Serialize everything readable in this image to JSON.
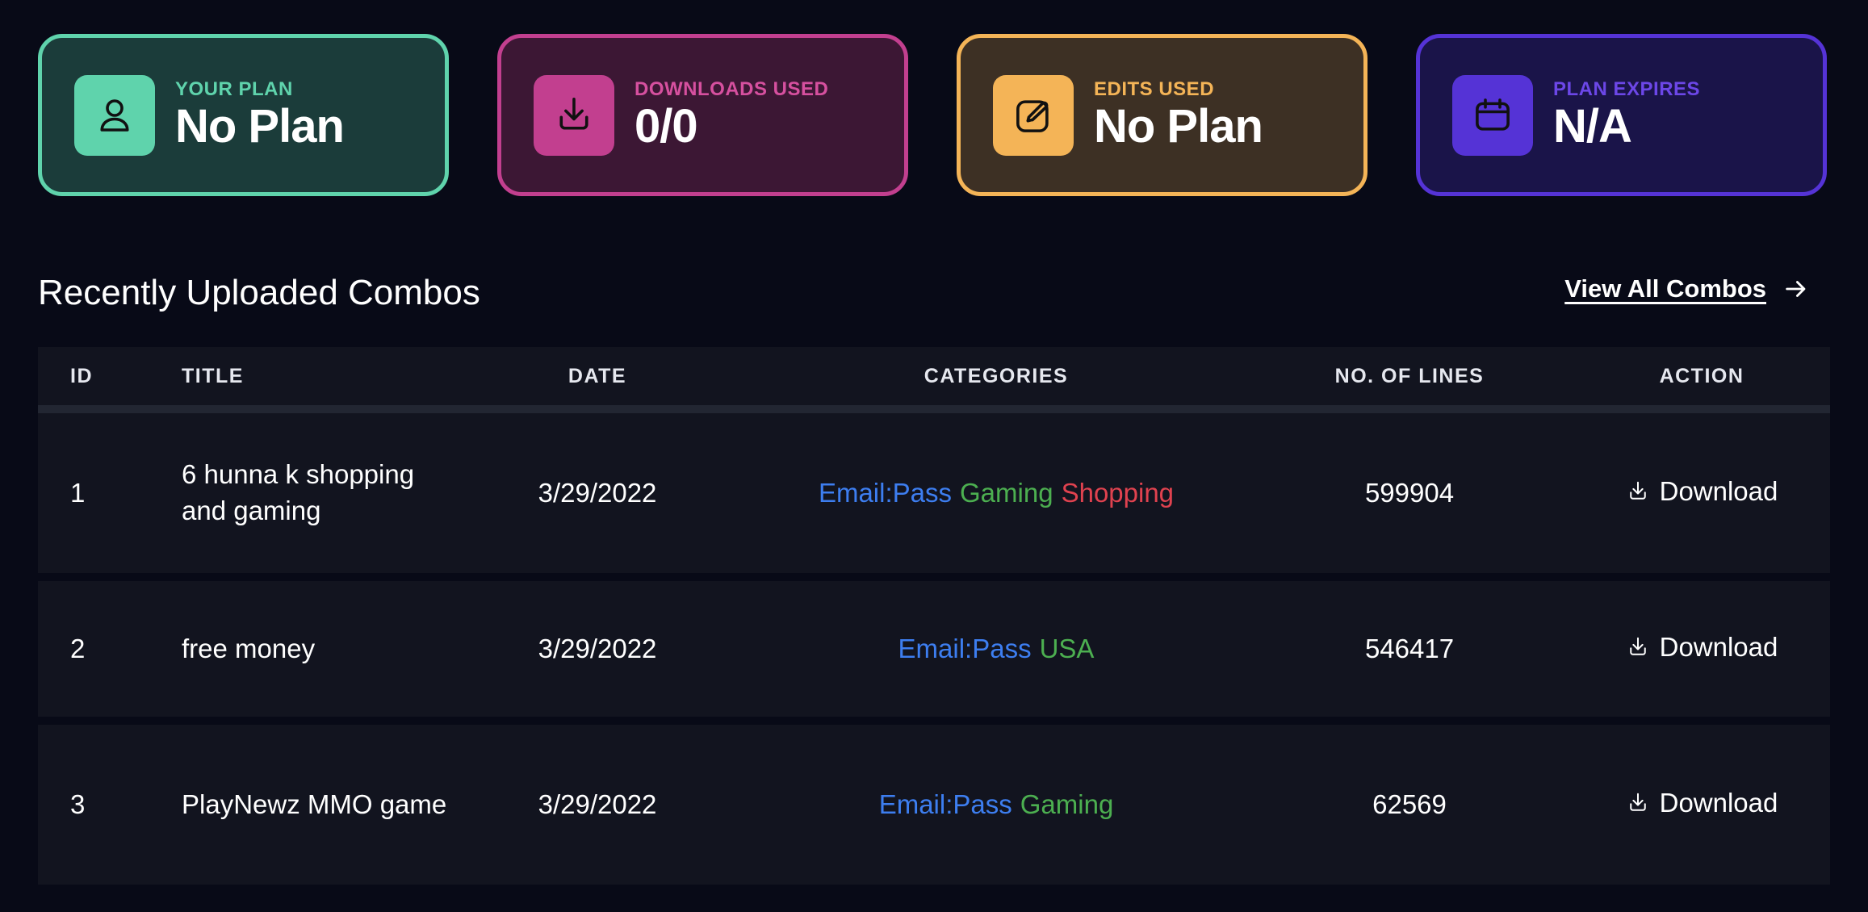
{
  "stats": [
    {
      "label": "YOUR PLAN",
      "value": "No Plan",
      "icon": "user-icon"
    },
    {
      "label": "DOWNLOADS USED",
      "value": "0/0",
      "icon": "download-icon"
    },
    {
      "label": "EDITS USED",
      "value": "No Plan",
      "icon": "edit-icon"
    },
    {
      "label": "PLAN EXPIRES",
      "value": "N/A",
      "icon": "calendar-icon"
    }
  ],
  "section": {
    "title": "Recently Uploaded Combos",
    "view_all_label": "View All Combos"
  },
  "table": {
    "headers": {
      "id": "ID",
      "title": "TITLE",
      "date": "DATE",
      "categories": "CATEGORIES",
      "lines": "NO. OF LINES",
      "action": "ACTION"
    },
    "rows": [
      {
        "id": "1",
        "title": "6 hunna k shopping and gaming",
        "date": "3/29/2022",
        "categories": [
          "Email:Pass",
          "Gaming",
          "Shopping"
        ],
        "lines": "599904",
        "action": "Download"
      },
      {
        "id": "2",
        "title": "free money",
        "date": "3/29/2022",
        "categories": [
          "Email:Pass",
          "USA"
        ],
        "lines": "546417",
        "action": "Download"
      },
      {
        "id": "3",
        "title": "PlayNewz MMO game",
        "date": "3/29/2022",
        "categories": [
          "Email:Pass",
          "Gaming"
        ],
        "lines": "62569",
        "action": "Download"
      }
    ]
  },
  "colors": {
    "category_email_pass": "#3d7ef0",
    "category_green": "#4caf50",
    "category_shopping": "#e0424f"
  }
}
